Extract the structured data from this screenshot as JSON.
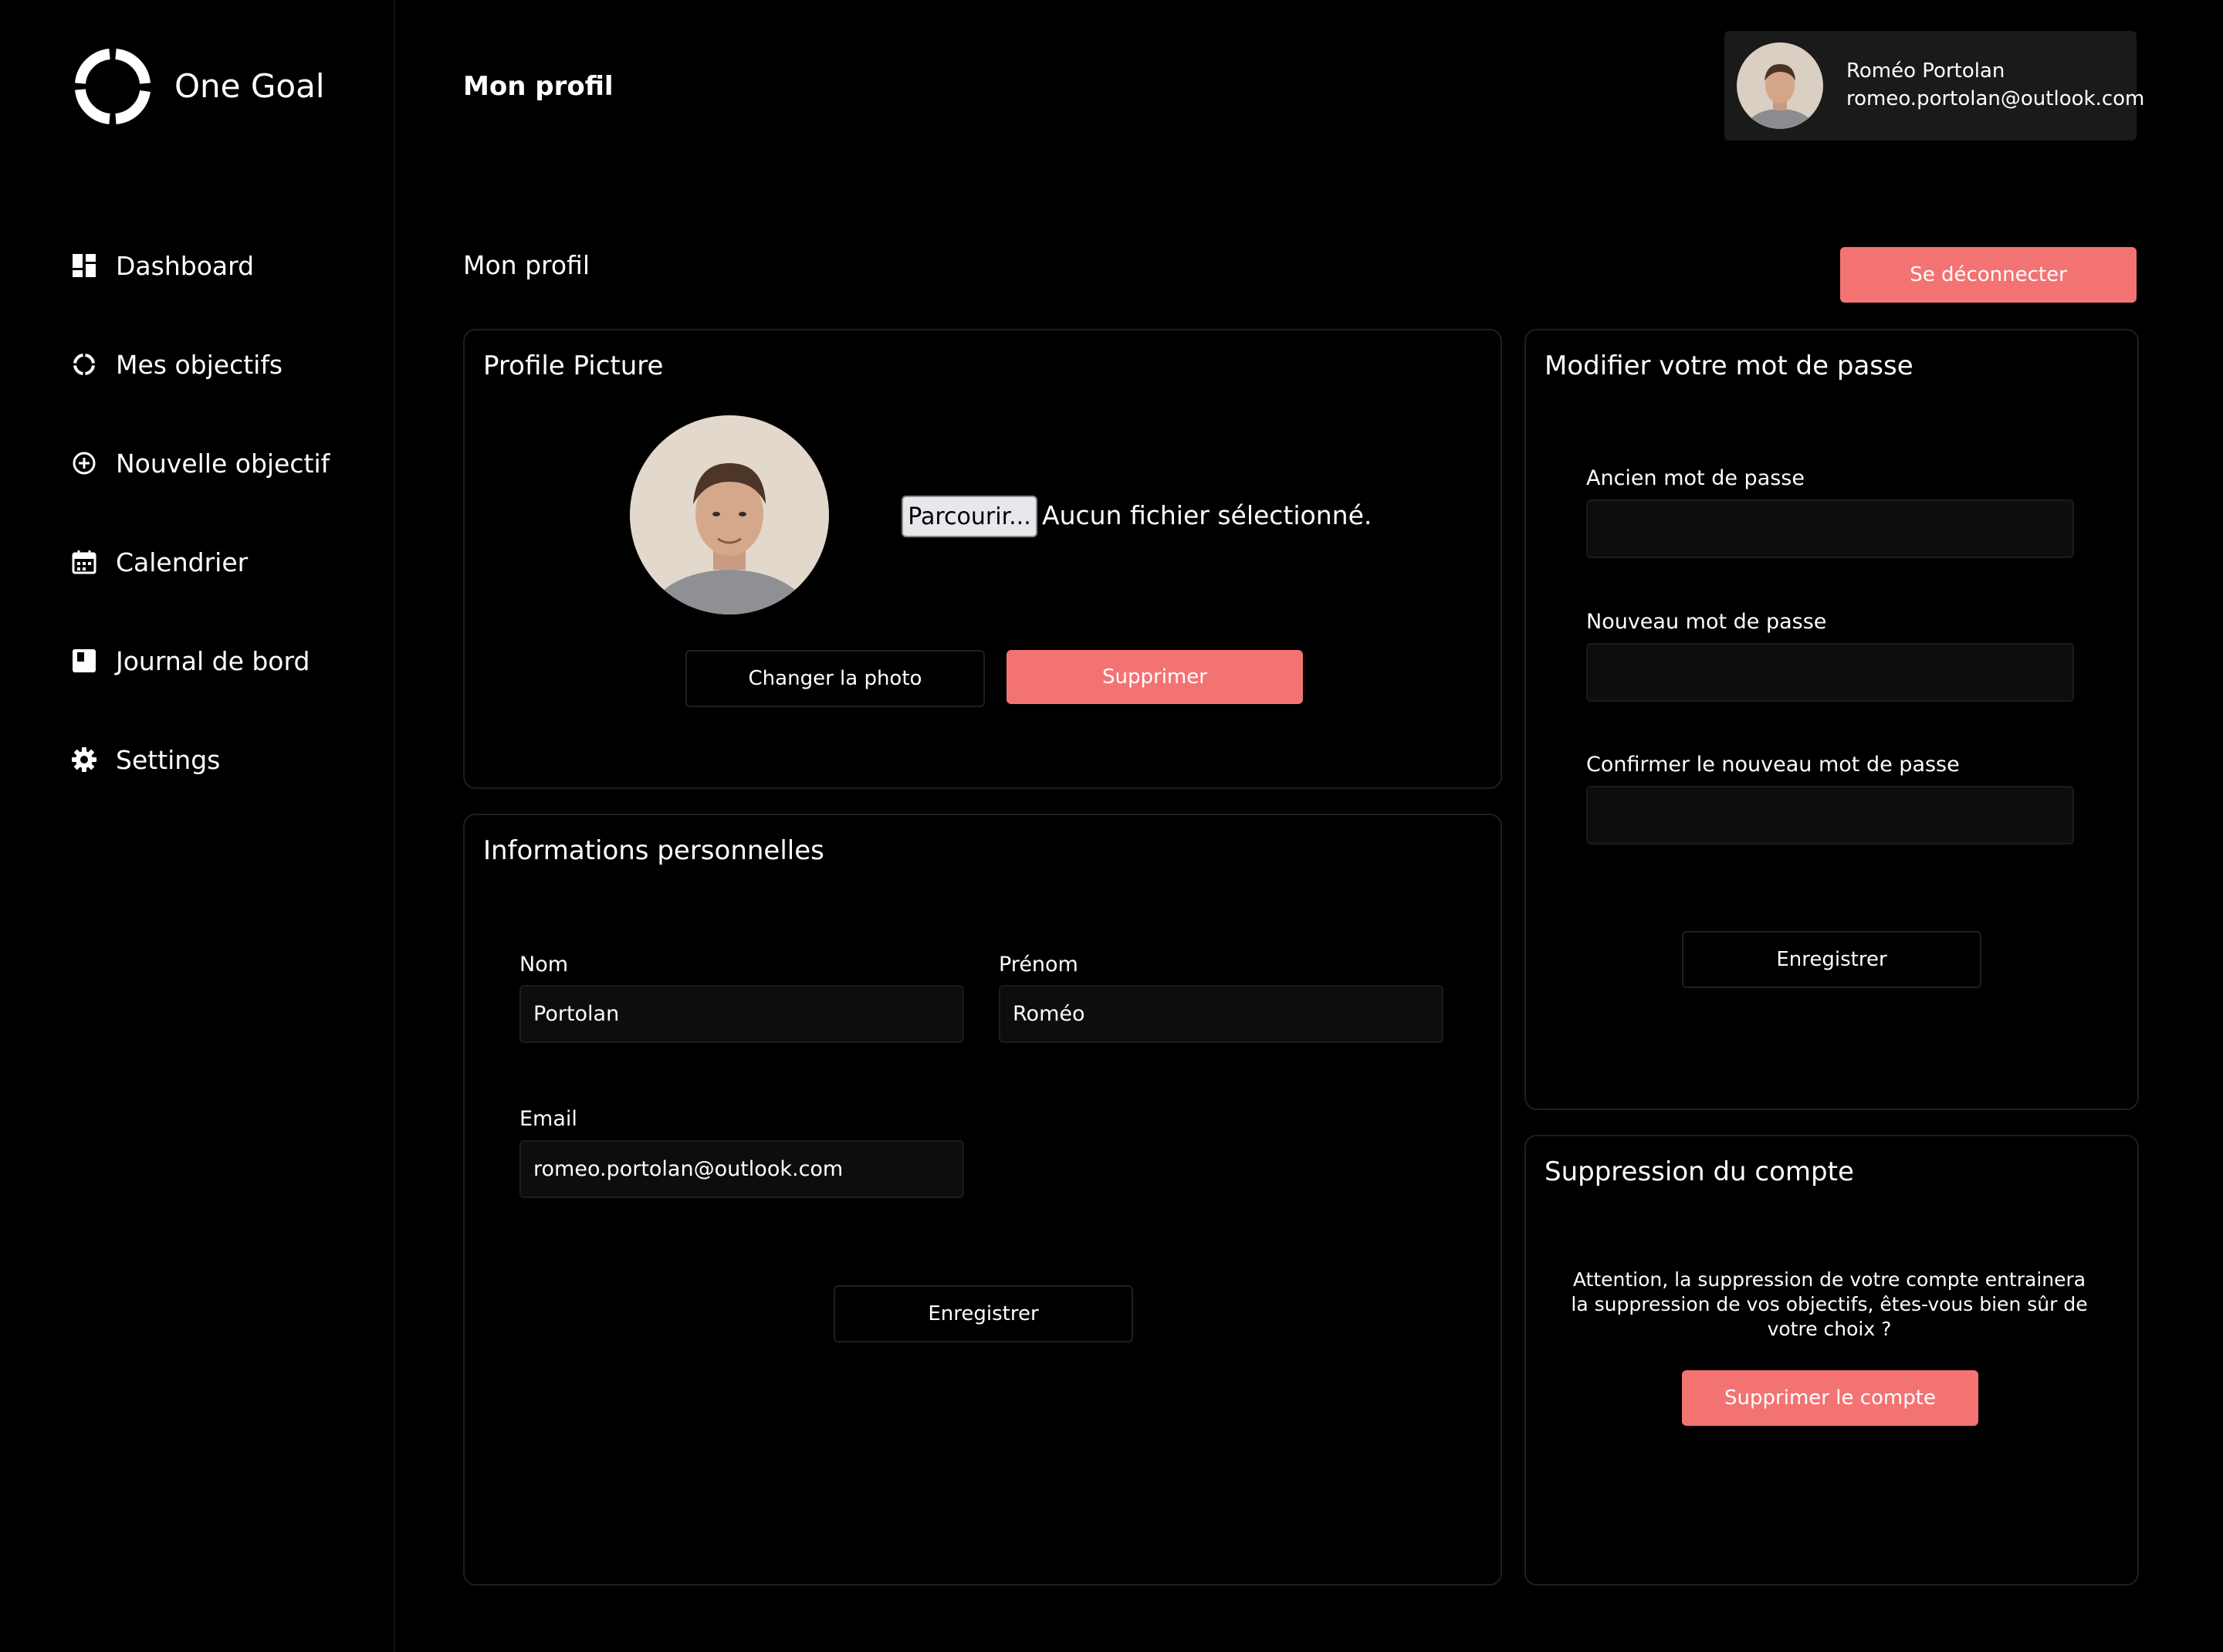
{
  "app": {
    "name": "One Goal"
  },
  "sidebar": {
    "items": [
      {
        "label": "Dashboard",
        "icon": "dashboard-icon"
      },
      {
        "label": "Mes objectifs",
        "icon": "goal-ring-icon"
      },
      {
        "label": "Nouvelle objectif",
        "icon": "plus-circle-icon"
      },
      {
        "label": "Calendrier",
        "icon": "calendar-icon"
      },
      {
        "label": "Journal de bord",
        "icon": "journal-icon"
      },
      {
        "label": "Settings",
        "icon": "gear-icon"
      }
    ]
  },
  "header": {
    "title": "Mon profil"
  },
  "user": {
    "name": "Roméo Portolan",
    "email": "romeo.portolan@outlook.com"
  },
  "page": {
    "subtitle": "Mon profil",
    "logout_label": "Se déconnecter"
  },
  "profile_picture": {
    "title": "Profile Picture",
    "browse_label": "Parcourir...",
    "no_file_text": "Aucun fichier sélectionné.",
    "change_label": "Changer la photo",
    "delete_label": "Supprimer"
  },
  "personal_info": {
    "title": "Informations personnelles",
    "nom_label": "Nom",
    "nom_value": "Portolan",
    "prenom_label": "Prénom",
    "prenom_value": "Roméo",
    "email_label": "Email",
    "email_value": "romeo.portolan@outlook.com",
    "save_label": "Enregistrer"
  },
  "password": {
    "title": "Modifier votre mot de passe",
    "old_label": "Ancien mot de passe",
    "new_label": "Nouveau mot de passe",
    "confirm_label": "Confirmer le nouveau mot de passe",
    "save_label": "Enregistrer"
  },
  "delete_account": {
    "title": "Suppression du compte",
    "warning": "Attention, la suppression de votre compte entrainera la suppression de vos objectifs, êtes-vous bien sûr de votre choix ?",
    "button_label": "Supprimer le compte"
  },
  "colors": {
    "accent": "#f37373",
    "background": "#000000",
    "card_border": "#1e1e1e",
    "input_bg": "#0d0d0d"
  }
}
